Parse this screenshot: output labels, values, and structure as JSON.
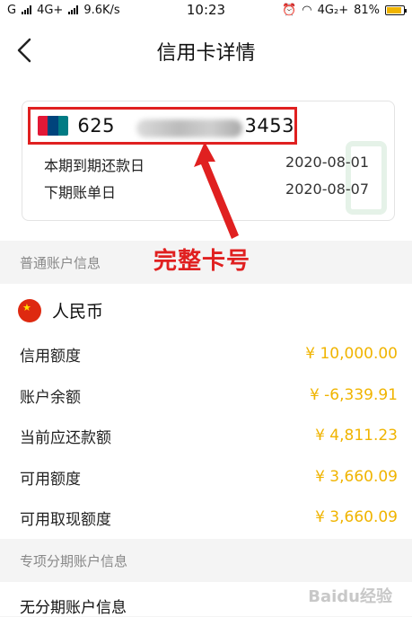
{
  "status_bar": {
    "left_text": "G",
    "network": "4G+",
    "speed": "9.6K/s",
    "time": "10:23",
    "right_network": "4G₂+",
    "battery": "81%",
    "battery_level": 0.81
  },
  "header": {
    "title": "信用卡详情"
  },
  "card": {
    "number_prefix": "625",
    "number_suffix": "3453",
    "due_label": "本期到期还款日",
    "due_date": "2020-08-01",
    "next_bill_label": "下期账单日",
    "next_bill_date": "2020-08-07"
  },
  "annotation": "完整卡号",
  "account": {
    "section_title": "普通账户信息",
    "currency": "人民币",
    "rows": [
      {
        "label": "信用额度",
        "value": "¥ 10,000.00"
      },
      {
        "label": "账户余额",
        "value": "¥ -6,339.91"
      },
      {
        "label": "当前应还款额",
        "value": "¥ 4,811.23"
      },
      {
        "label": "可用额度",
        "value": "¥ 3,660.09"
      },
      {
        "label": "可用取现额度",
        "value": "¥ 3,660.09"
      }
    ]
  },
  "installment": {
    "section_title": "专项分期账户信息",
    "empty_text": "无分期账户信息"
  },
  "watermark": "Baidu经验",
  "colors": {
    "accent_red": "#e02020",
    "amount_gold": "#f0b400"
  }
}
